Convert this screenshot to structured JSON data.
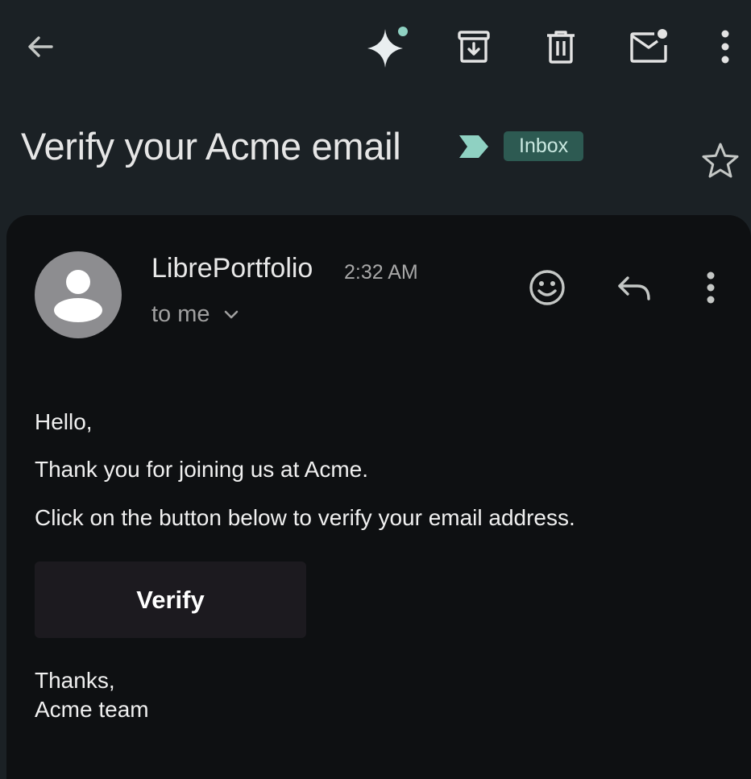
{
  "toolbar": {
    "back_icon": "arrow-left-icon",
    "actions": [
      {
        "name": "gemini-sparkle-icon"
      },
      {
        "name": "archive-icon"
      },
      {
        "name": "trash-icon"
      },
      {
        "name": "mark-unread-icon"
      },
      {
        "name": "more-vert-icon"
      }
    ]
  },
  "email": {
    "subject": "Verify your Acme email",
    "label": "Inbox",
    "sender": "LibrePortfolio",
    "time": "2:32 AM",
    "recipient": "to me",
    "body": {
      "greeting": "Hello,",
      "line1": "Thank you for joining us at Acme.",
      "line2": "Click on the button below to verify your email address.",
      "button_label": "Verify",
      "closing": "Thanks,",
      "signature": "Acme team"
    }
  },
  "colors": {
    "background": "#1b2125",
    "card": "#0e1012",
    "label_chip": "#2d5a52",
    "importance": "#8fd1c2",
    "button": "#1c1a1f"
  }
}
